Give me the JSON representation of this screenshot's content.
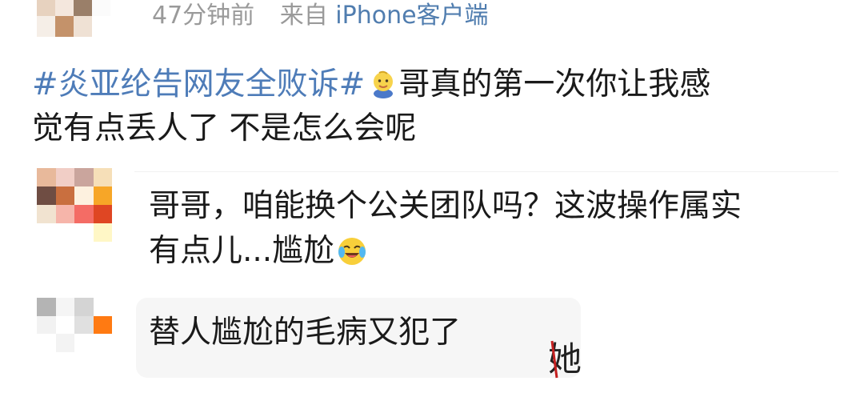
{
  "post": {
    "meta": {
      "time": "47分钟前",
      "source_prefix": "来自",
      "device": "iPhone客户端"
    },
    "hashtag": "#炎亚纶告网友全败诉#",
    "emoji": "baby-face-emoji",
    "text_line_1": "哥真的第一次你让我感",
    "text_line_2": "觉有点丢人了 不是怎么会呢"
  },
  "comments": [
    {
      "text_line_1": "哥哥，咱能换个公关团队吗？这波操作属实",
      "text_line_2": "有点儿...尴尬",
      "emoji": "laugh-cry-emoji"
    },
    {
      "text": "替人尴尬的毛病又犯了"
    }
  ],
  "watermark": {
    "glyph": "她"
  },
  "colors": {
    "hashtag": "#4e7cb8",
    "device": "#507daf",
    "meta": "#9a9a9a",
    "bubble": "#f6f6f6",
    "text": "#1a1a1a"
  }
}
